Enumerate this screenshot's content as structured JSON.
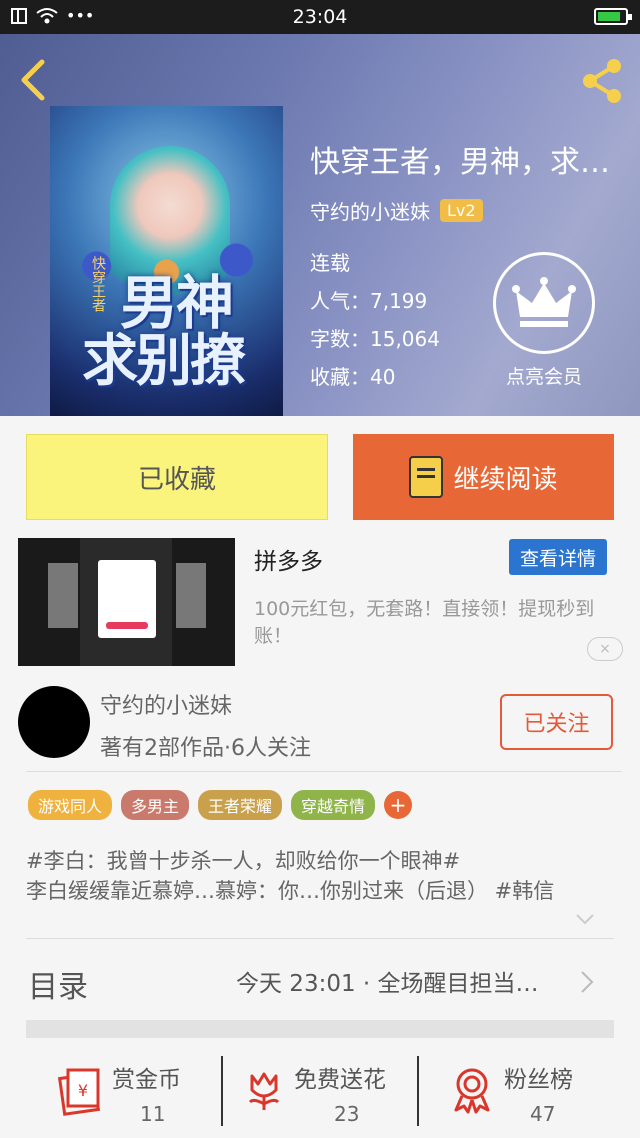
{
  "status_bar": {
    "time": "23:04"
  },
  "book": {
    "title": "快穿王者，男神，求…",
    "author": "守约的小迷妹",
    "level": "Lv2",
    "status": "连载",
    "popularity": "人气：7,199",
    "word_count": "字数：15,064",
    "favorites": "收藏：40",
    "cover_text": [
      "男神",
      "求别撩"
    ],
    "cover_badge": "快穿王者"
  },
  "vip": {
    "label": "点亮会员"
  },
  "actions": {
    "collected": "已收藏",
    "continue": "继续阅读"
  },
  "ad": {
    "title": "拼多多",
    "detail": "查看详情",
    "description": "100元红包，无套路！直接领！提现秒到账！",
    "close": "×"
  },
  "author_card": {
    "name": "守约的小迷妹",
    "stats": "著有2部作品·6人关注",
    "follow": "已关注"
  },
  "tags": [
    {
      "label": "游戏同人",
      "color": "#f0b23e"
    },
    {
      "label": "多男主",
      "color": "#c97a6c"
    },
    {
      "label": "王者荣耀",
      "color": "#c9a04b"
    },
    {
      "label": "穿越奇情",
      "color": "#8fb44a"
    }
  ],
  "description": {
    "line1": "#李白：我曾十步杀一人，却败给你一个眼神#",
    "line2": "李白缓缓靠近慕婷…慕婷：你…你别过来（后退） #韩信"
  },
  "toc": {
    "label": "目录",
    "latest": "今天 23:01 · 全场醒目担当…"
  },
  "bottom_stats": [
    {
      "label": "赏金币",
      "value": "11"
    },
    {
      "label": "免费送花",
      "value": "23"
    },
    {
      "label": "粉丝榜",
      "value": "47"
    }
  ],
  "colors": {
    "accent": "#e76836",
    "collected_bg": "#fbf47c",
    "ad_button": "#2b74cf",
    "follow": "#e45a38"
  }
}
